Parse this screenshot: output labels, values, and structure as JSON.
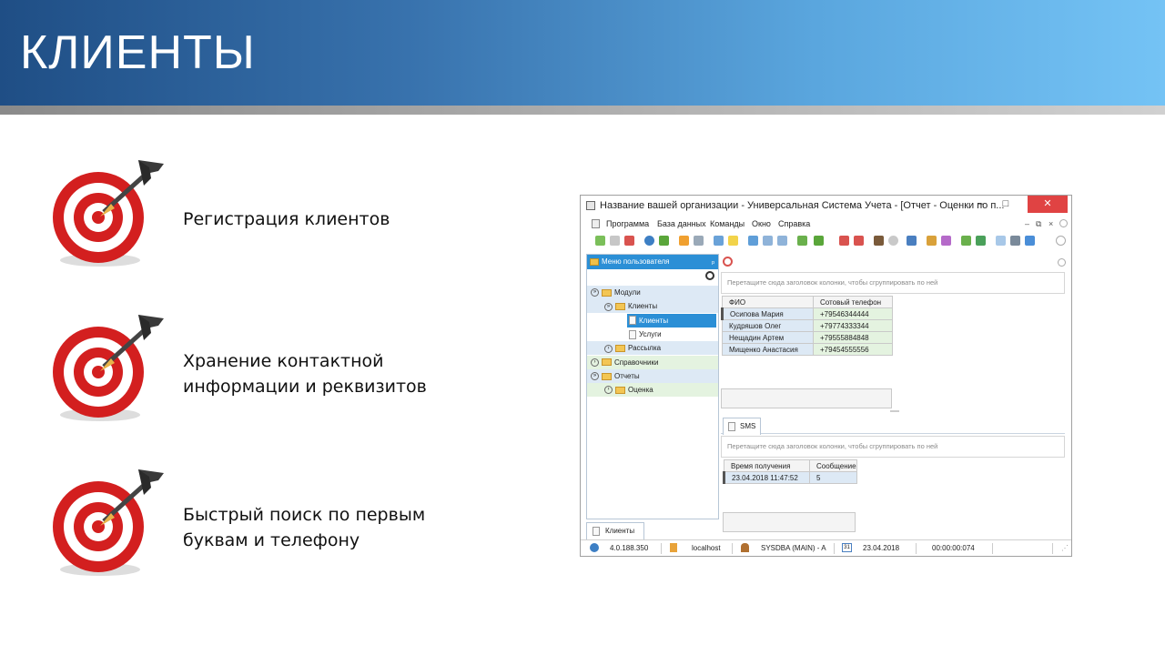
{
  "slide": {
    "title": "КЛИЕНТЫ",
    "bullets": [
      {
        "icon": "target-dart-icon",
        "lines": [
          "Регистрация клиентов"
        ]
      },
      {
        "icon": "target-dart-icon",
        "lines": [
          "Хранение контактной",
          "информации и реквизитов"
        ]
      },
      {
        "icon": "target-dart-icon",
        "lines": [
          "Быстрый поиск по первым",
          "буквам и телефону"
        ]
      }
    ]
  },
  "app": {
    "window_title": "Название вашей организации - Универсальная Система Учета - [Отчет - Оценки по п...",
    "window_buttons": {
      "minimize": "–",
      "maximize": "□",
      "close": "✕"
    },
    "menu": [
      "Программа",
      "База данных",
      "Команды",
      "Окно",
      "Справка"
    ],
    "menu_right": {
      "minimize": "–",
      "restore": "⧉",
      "close": "×"
    },
    "left_panel": {
      "header": "Меню пользователя",
      "pin": "ᵖ",
      "tree": [
        {
          "label": "Модули",
          "level": 0,
          "toggle": "»",
          "kind": "folder"
        },
        {
          "label": "Клиенты",
          "level": 1,
          "toggle": "»",
          "kind": "folder"
        },
        {
          "label": "Клиенты",
          "level": 2,
          "toggle": "",
          "kind": "doc",
          "selected": true
        },
        {
          "label": "Услуги",
          "level": 2,
          "toggle": "",
          "kind": "doc"
        },
        {
          "label": "Рассылка",
          "level": 1,
          "toggle": "›",
          "kind": "folder"
        },
        {
          "label": "Справочники",
          "level": 0,
          "toggle": "›",
          "kind": "folder"
        },
        {
          "label": "Отчеты",
          "level": 0,
          "toggle": "»",
          "kind": "folder"
        },
        {
          "label": "Оценка",
          "level": 1,
          "toggle": "›",
          "kind": "folder"
        }
      ],
      "bottom_tab": "Клиенты"
    },
    "grid1": {
      "group_hint": "Перетащите сюда заголовок колонки, чтобы сгруппировать по ней",
      "columns": [
        "ФИО",
        "Сотовый телефон"
      ],
      "rows": [
        [
          "Осипова Мария",
          "+79546344444"
        ],
        [
          "Кудряшов Олег",
          "+79774333344"
        ],
        [
          "Нещадин Артем",
          "+79555884848"
        ],
        [
          "Мищенко Анастасия",
          "+79454555556"
        ]
      ]
    },
    "detail_tab": "SMS",
    "grid2": {
      "group_hint": "Перетащите сюда заголовок колонки, чтобы сгруппировать по ней",
      "columns": [
        "Время получения",
        "Сообщение"
      ],
      "rows": [
        [
          "23.04.2018 11:47:52",
          "5"
        ]
      ]
    },
    "status": {
      "version": "4.0.188.350",
      "server": "localhost",
      "user": "SYSDBA (MAIN) - A",
      "calendar_day": "31",
      "date": "23.04.2018",
      "timer": "00:00:00:074"
    }
  }
}
